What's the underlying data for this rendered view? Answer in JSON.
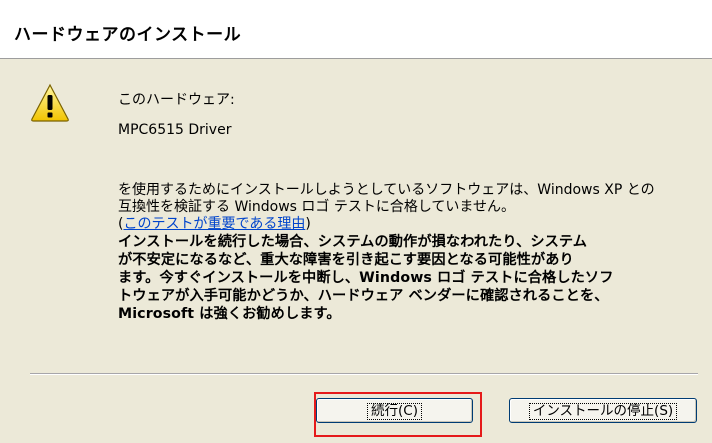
{
  "window": {
    "title": "ハードウェアのインストール"
  },
  "message": {
    "intro": "このハードウェア:",
    "device_name": "MPC6515 Driver",
    "line1": "を使用するためにインストールしようとしているソフトウェアは、Windows XP との",
    "line2": "互換性を検証する Windows ロゴ テストに合格していません。",
    "link_open": "(",
    "link_text": "このテストが重要である理由",
    "link_close": ")"
  },
  "warning": {
    "line1": "インストールを続行した場合、システムの動作が損なわれたり、システム",
    "line2": "が不安定になるなど、重大な障害を引き起こす要因となる可能性があり",
    "line3": "ます。今すぐインストールを中断し、Windows ロゴ テストに合格したソフ",
    "line4": "トウェアが入手可能かどうか、ハードウェア ベンダーに確認されることを、",
    "line5": "Microsoft は強くお勧めします。"
  },
  "buttons": {
    "continue_label": "続行(C)",
    "stop_label": "インストールの停止(S)"
  },
  "icons": {
    "warning": "warning-icon"
  },
  "colors": {
    "dialog_background": "#ece9d8",
    "link": "#0044cc",
    "highlight": "#e51a1a"
  }
}
